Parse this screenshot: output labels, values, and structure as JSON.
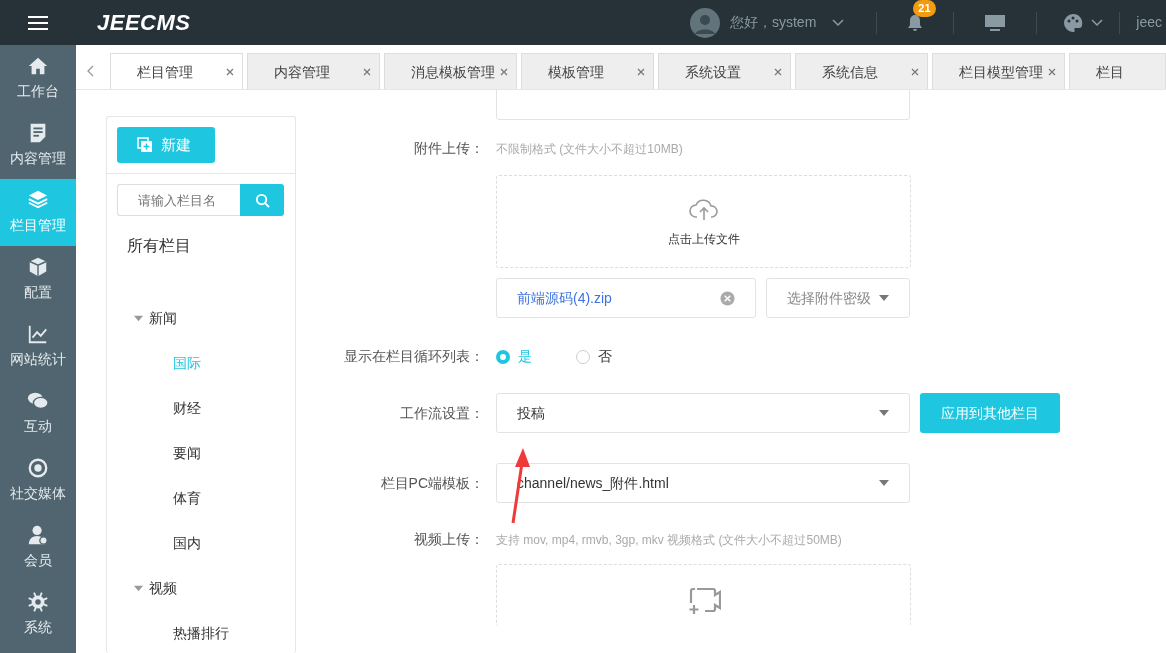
{
  "header": {
    "logo": "JEECMS",
    "greeting": "您好，system",
    "notification_count": "21",
    "user_text": "jeec"
  },
  "sidebar": {
    "items": [
      {
        "label": "工作台",
        "selected": false
      },
      {
        "label": "内容管理",
        "selected": false
      },
      {
        "label": "栏目管理",
        "selected": true
      },
      {
        "label": "配置",
        "selected": false
      },
      {
        "label": "网站统计",
        "selected": false
      },
      {
        "label": "互动",
        "selected": false
      },
      {
        "label": "社交媒体",
        "selected": false
      },
      {
        "label": "会员",
        "selected": false
      },
      {
        "label": "系统",
        "selected": false
      }
    ]
  },
  "tabs": [
    {
      "label": "栏目管理",
      "selected": true
    },
    {
      "label": "内容管理",
      "selected": false
    },
    {
      "label": "消息模板管理",
      "selected": false
    },
    {
      "label": "模板管理",
      "selected": false
    },
    {
      "label": "系统设置",
      "selected": false
    },
    {
      "label": "系统信息",
      "selected": false
    },
    {
      "label": "栏目模型管理",
      "selected": false
    },
    {
      "label": "栏目",
      "selected": false
    }
  ],
  "channel_panel": {
    "new_button": "新建",
    "search": {
      "placeholder": "请输入栏目名"
    },
    "root": "所有栏目",
    "tree": [
      {
        "label": "新闻",
        "expanded": true,
        "selected": false,
        "children": [
          {
            "label": "国际",
            "selected": true
          },
          {
            "label": "财经",
            "selected": false
          },
          {
            "label": "要闻",
            "selected": false
          },
          {
            "label": "体育",
            "selected": false
          },
          {
            "label": "国内",
            "selected": false
          }
        ]
      },
      {
        "label": "视频",
        "expanded": true,
        "selected": false,
        "children": [
          {
            "label": "热播排行",
            "selected": false
          }
        ]
      }
    ]
  },
  "form": {
    "attachment": {
      "label": "附件上传：",
      "hint": "不限制格式 (文件大小不超过10MB)",
      "upload_text": "点击上传文件",
      "file_name": "前端源码(4).zip",
      "secrecy_placeholder": "选择附件密级"
    },
    "show_in_loop": {
      "label": "显示在栏目循环列表：",
      "options": [
        {
          "label": "是",
          "selected": true
        },
        {
          "label": "否",
          "selected": false
        }
      ]
    },
    "workflow": {
      "label": "工作流设置：",
      "value": "投稿",
      "apply_button": "应用到其他栏目"
    },
    "pc_template": {
      "label": "栏目PC端模板：",
      "value": "channel/news_附件.html"
    },
    "video": {
      "label": "视频上传：",
      "hint": "支持 mov, mp4, rmvb, 3gp, mkv 视频格式 (文件大小不超过50MB)"
    }
  }
}
